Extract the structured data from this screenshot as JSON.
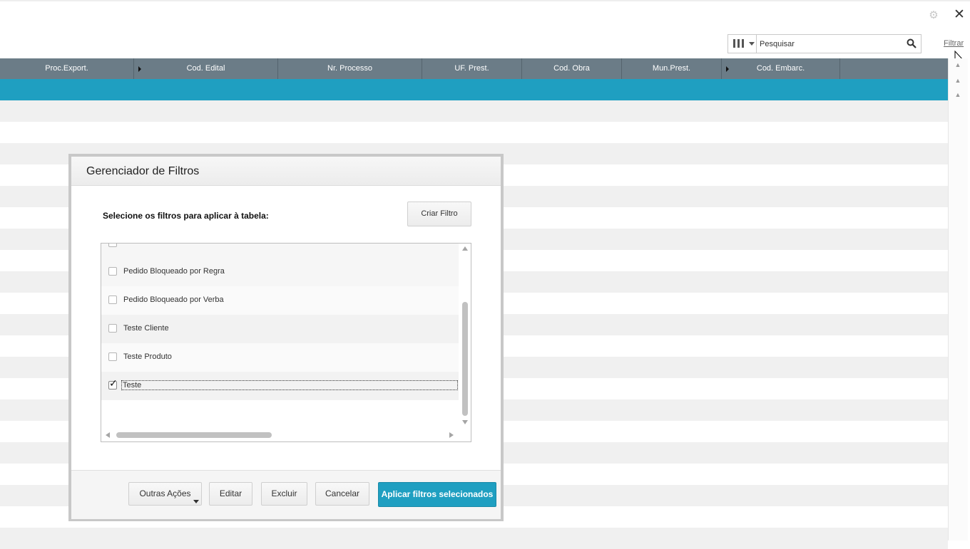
{
  "toolbar": {
    "search_placeholder": "Pesquisar",
    "filter_link": "Filtrar"
  },
  "table": {
    "columns": [
      {
        "label": "Proc.Export."
      },
      {
        "label": "Cod. Edital"
      },
      {
        "label": "Nr. Processo"
      },
      {
        "label": "UF. Prest."
      },
      {
        "label": "Cod. Obra"
      },
      {
        "label": "Mun.Prest."
      },
      {
        "label": "Cod. Embarc."
      }
    ],
    "header_color": "#6b7c87",
    "selected_row_color": "#1f9fc1",
    "stripe_color": "#f0f0f0"
  },
  "dialog": {
    "title": "Gerenciador de Filtros",
    "instruction": "Selecione os filtros para aplicar à tabela:",
    "create_button": "Criar Filtro",
    "filters": [
      {
        "label": "Pedido Bloqueado por Regra",
        "checked": false
      },
      {
        "label": "Pedido Bloqueado por Verba",
        "checked": false
      },
      {
        "label": "Teste Cliente",
        "checked": false
      },
      {
        "label": "Teste Produto",
        "checked": false
      },
      {
        "label": "Teste",
        "checked": true
      }
    ],
    "buttons": {
      "other_actions": "Outras Ações",
      "edit": "Editar",
      "delete": "Excluir",
      "cancel": "Cancelar",
      "apply": "Aplicar filtros selecionados"
    },
    "accent_color": "#1f9fc1"
  }
}
